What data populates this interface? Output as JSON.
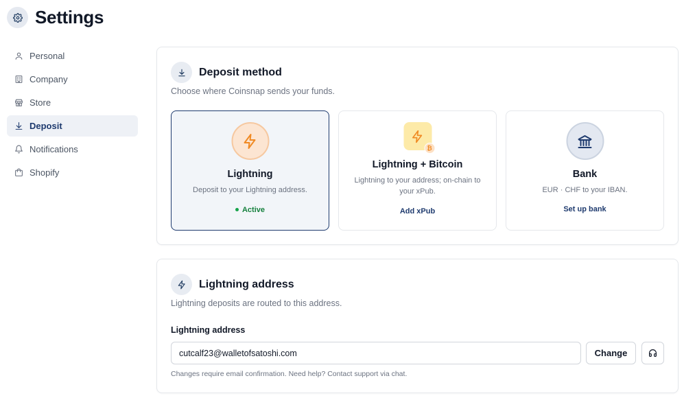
{
  "page": {
    "title": "Settings",
    "icon": "gear-icon"
  },
  "sidebar": {
    "items": [
      {
        "label": "Personal",
        "icon": "user-icon",
        "active": false
      },
      {
        "label": "Company",
        "icon": "building-icon",
        "active": false
      },
      {
        "label": "Store",
        "icon": "store-icon",
        "active": false
      },
      {
        "label": "Deposit",
        "icon": "download-icon",
        "active": true
      },
      {
        "label": "Notifications",
        "icon": "bell-icon",
        "active": false
      },
      {
        "label": "Shopify",
        "icon": "shopping-bag-icon",
        "active": false
      }
    ]
  },
  "deposit": {
    "title": "Deposit method",
    "subtitle": "Choose where Coinsnap sends your funds.",
    "options": [
      {
        "name": "Lightning",
        "description": "Deposit to your Lightning address.",
        "status": "Active",
        "icon": "lightning-icon",
        "selected": true
      },
      {
        "name": "Lightning + Bitcoin",
        "description": "Lightning to your address; on-chain to your xPub.",
        "action": "Add xPub",
        "icon": "lightning-bitcoin-icon",
        "selected": false
      },
      {
        "name": "Bank",
        "description": "EUR · CHF to your IBAN.",
        "action": "Set up bank",
        "icon": "bank-icon",
        "selected": false
      }
    ]
  },
  "lightning_address": {
    "title": "Lightning address",
    "subtitle": "Lightning deposits are routed to this address.",
    "field_label": "Lightning address",
    "value": "cutcalf23@walletofsatoshi.com",
    "change_label": "Change",
    "support_icon": "headset-icon",
    "help": "Changes require email confirmation. Need help? Contact support via chat."
  },
  "colors": {
    "accent": "#1e3a6e",
    "active_status": "#15803d",
    "lightning_orange": "#f08a24",
    "active_nav_bg": "#eef1f6"
  }
}
